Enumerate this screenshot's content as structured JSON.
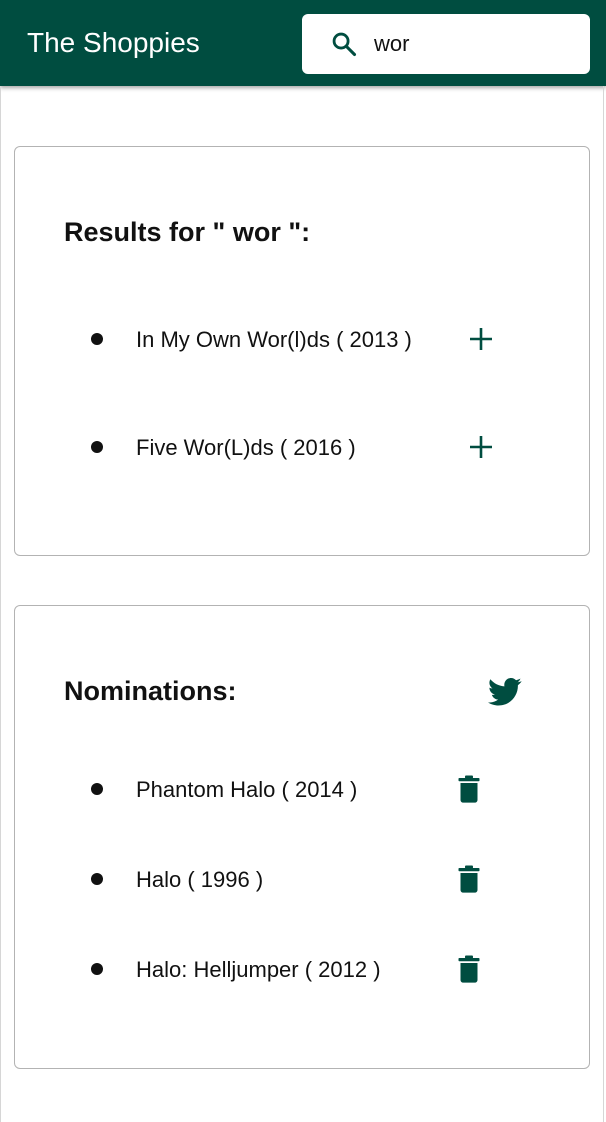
{
  "app": {
    "title": "The Shoppies",
    "brand_color": "#004d40"
  },
  "search": {
    "value": "wor",
    "icon": "search-icon"
  },
  "results": {
    "heading": "Results for \" wor \":",
    "items": [
      {
        "label": "In My Own Wor(l)ds ( 2013 )",
        "action_icon": "plus-icon"
      },
      {
        "label": "Five Wor(L)ds ( 2016 )",
        "action_icon": "plus-icon"
      }
    ]
  },
  "nominations": {
    "heading": "Nominations:",
    "share_icon": "twitter-icon",
    "items": [
      {
        "label": "Phantom Halo ( 2014 )",
        "action_icon": "trash-icon"
      },
      {
        "label": "Halo ( 1996 )",
        "action_icon": "trash-icon"
      },
      {
        "label": "Halo: Helljumper ( 2012 )",
        "action_icon": "trash-icon"
      }
    ]
  }
}
